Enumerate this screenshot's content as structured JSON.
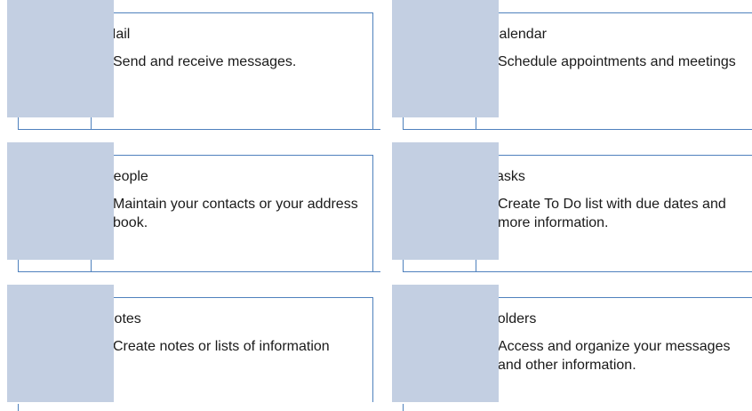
{
  "cards": [
    {
      "title": "Mail",
      "description": "Send and receive messages."
    },
    {
      "title": "Calendar",
      "description": "Schedule appointments and meetings"
    },
    {
      "title": "People",
      "description": "Maintain your contacts or your address book."
    },
    {
      "title": "Tasks",
      "description": "Create To Do list with due dates and more information."
    },
    {
      "title": "Notes",
      "description": "Create notes or lists of information"
    },
    {
      "title": "Folders",
      "description": "Access and organize your messages and other information."
    }
  ],
  "bullet_glyph": "•",
  "colors": {
    "accent_border": "#4f81bd",
    "swatch_fill": "#c3cfe2"
  }
}
